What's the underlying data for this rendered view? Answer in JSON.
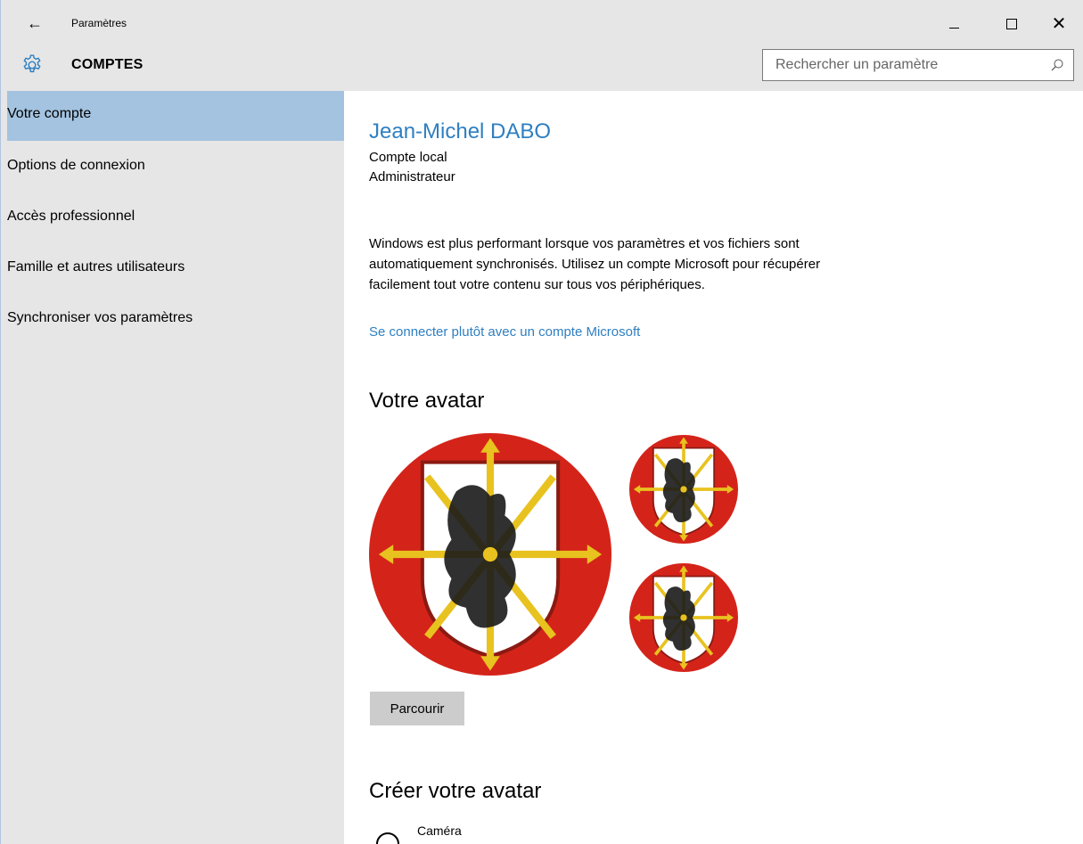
{
  "window": {
    "title": "Paramètres",
    "back_glyph": "←",
    "close_glyph": "✕"
  },
  "header": {
    "section_title": "COMPTES",
    "search_placeholder": "Rechercher un paramètre"
  },
  "sidebar": {
    "items": [
      {
        "label": "Votre compte",
        "selected": true
      },
      {
        "label": "Options de connexion"
      },
      {
        "label": "Accès professionnel"
      },
      {
        "label": "Famille et autres utilisateurs"
      },
      {
        "label": "Synchroniser vos paramètres"
      }
    ]
  },
  "account": {
    "name": "Jean-Michel DABO",
    "type": "Compte local",
    "role": "Administrateur",
    "sync_message": "Windows est plus performant lorsque vos paramètres et vos fichiers sont automatiquement synchronisés. Utilisez un compte Microsoft pour récupérer facilement tout votre contenu sur tous vos périphériques.",
    "ms_link": "Se connecter plutôt avec un compte Microsoft"
  },
  "avatar": {
    "heading": "Votre avatar",
    "browse_label": "Parcourir",
    "create_heading": "Créer votre avatar",
    "camera_label": "Caméra"
  },
  "colors": {
    "accent": "#2e7fc1",
    "selected_nav": "#a3c3e0",
    "chrome": "#e6e6e6",
    "coat_red": "#d4241a",
    "coat_gold": "#e8c21f"
  }
}
